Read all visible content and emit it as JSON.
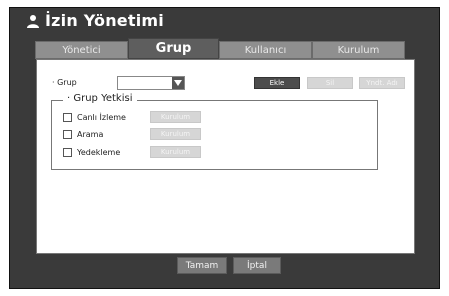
{
  "title": "İzin Yönetimi",
  "tabs": [
    {
      "label": "Yönetici",
      "active": false
    },
    {
      "label": "Grup",
      "active": true
    },
    {
      "label": "Kullanıcı",
      "active": false
    },
    {
      "label": "Kurulum",
      "active": false
    }
  ],
  "group": {
    "label": "· Grup",
    "selected_value": "",
    "add_label": "Ekle",
    "delete_label": "Sil",
    "rename_label": "Yndt. Adı"
  },
  "permissions": {
    "legend": "· Grup Yetkisi",
    "items": [
      {
        "label": "Canlı İzleme",
        "setup_label": "Kurulum",
        "checked": false
      },
      {
        "label": "Arama",
        "setup_label": "Kurulum",
        "checked": false
      },
      {
        "label": "Yedekleme",
        "setup_label": "Kurulum",
        "checked": false
      }
    ]
  },
  "footer": {
    "ok_label": "Tamam",
    "cancel_label": "İptal"
  },
  "icons": {
    "title": "user-icon",
    "select_arrow": "chevron-down-icon"
  },
  "colors": {
    "frame": "#3a3a3a",
    "active_tab": "#5e5e5e",
    "inactive_tab": "#8f8f8f",
    "panel": "#ffffff",
    "dark_button": "#4c4c4c",
    "disabled_button": "#d6d6d6"
  }
}
